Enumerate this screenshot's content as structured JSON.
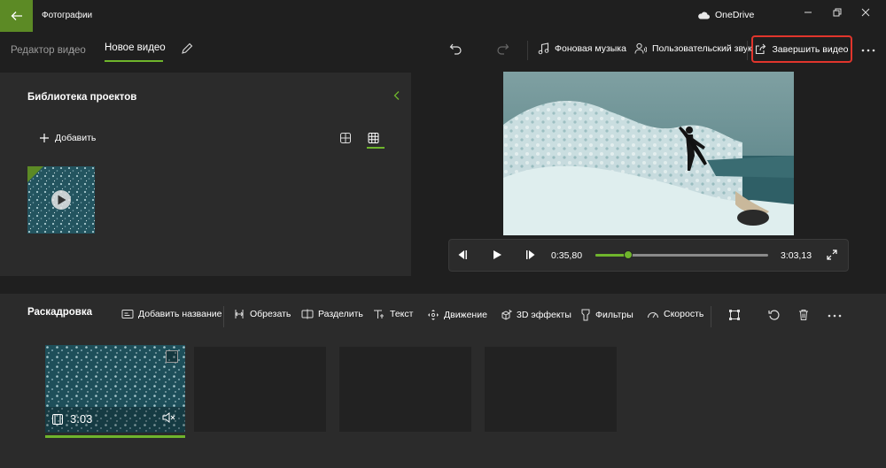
{
  "app": {
    "title": "Фотографии",
    "cloud_label": "OneDrive",
    "accent": "#6fb52c",
    "back_color": "#5c8a25",
    "highlight": "#e1352c"
  },
  "breadcrumb": {
    "parent": "Редактор видео",
    "current": "Новое видео"
  },
  "toolbar": {
    "music_label": "Фоновая музыка",
    "custom_audio_label": "Пользовательский звук",
    "finish_label": "Завершить видео"
  },
  "library": {
    "title": "Библиотека проектов",
    "add_label": "Добавить"
  },
  "player": {
    "current_time": "0:35,80",
    "total_time": "3:03,13",
    "progress": 0.19
  },
  "storyboard": {
    "title": "Раскадровка",
    "tools": [
      {
        "label": "Добавить название",
        "icon": "title-card-icon"
      },
      {
        "label": "Обрезать",
        "icon": "trim-icon"
      },
      {
        "label": "Разделить",
        "icon": "split-icon"
      },
      {
        "label": "Текст",
        "icon": "text-icon"
      },
      {
        "label": "Движение",
        "icon": "motion-icon"
      },
      {
        "label": "3D эффекты",
        "icon": "3d-effects-icon"
      },
      {
        "label": "Фильтры",
        "icon": "filters-icon"
      },
      {
        "label": "Скорость",
        "icon": "speed-icon"
      }
    ],
    "clip_duration": "3:03"
  }
}
